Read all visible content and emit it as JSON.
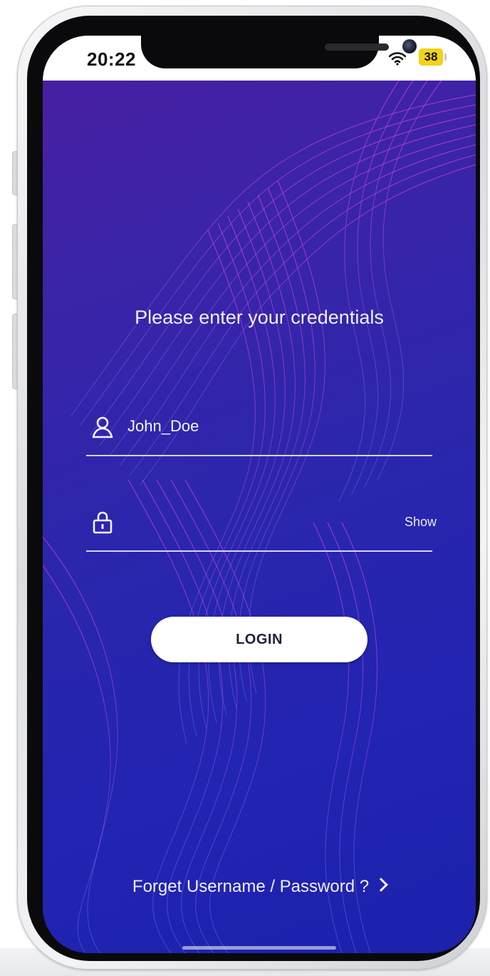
{
  "status_bar": {
    "time": "20:22",
    "wifi_icon": "wifi-icon",
    "battery_level": "38",
    "battery_color": "#f2d21b"
  },
  "login": {
    "prompt": "Please enter your credentials",
    "username": {
      "icon": "user-icon",
      "value": "John_Doe"
    },
    "password": {
      "icon": "lock-icon",
      "value": "",
      "show_label": "Show"
    },
    "login_button": "LOGIN",
    "forgot_link": "Forget Username / Password ?",
    "forgot_icon": "chevron-right-icon"
  },
  "theme": {
    "background_start": "#4a1fa0",
    "background_end": "#1b22ac",
    "wave_color": "#b03ad8"
  }
}
